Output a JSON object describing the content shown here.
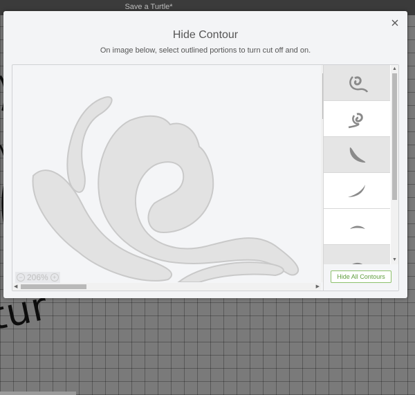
{
  "app": {
    "document_title": "Save a Turtle*"
  },
  "background": {
    "canvas_text": "tur"
  },
  "dialog": {
    "title": "Hide Contour",
    "subtitle": "On image below, select outlined portions to turn cut off and on.",
    "zoom_level": "206%",
    "zoom_out_icon": "minus-icon",
    "zoom_in_icon": "plus-icon",
    "hide_all_label": "Hide All Contours",
    "contours": [
      {
        "shape": "spiral-small",
        "state": "hidden"
      },
      {
        "shape": "spiral-large",
        "state": "visible"
      },
      {
        "shape": "curved-leaf",
        "state": "hidden"
      },
      {
        "shape": "leaf-upturn",
        "state": "visible"
      },
      {
        "shape": "arc-small",
        "state": "visible"
      },
      {
        "shape": "spiral-partial",
        "state": "hidden"
      }
    ]
  },
  "colors": {
    "accent_green": "#5f9d3c",
    "shape_fill": "#e2e2e2",
    "shape_outline": "#c9c9c9",
    "thumbnail_fill": "#8a8a8a",
    "hidden_row_bg": "#e5e5e5"
  }
}
